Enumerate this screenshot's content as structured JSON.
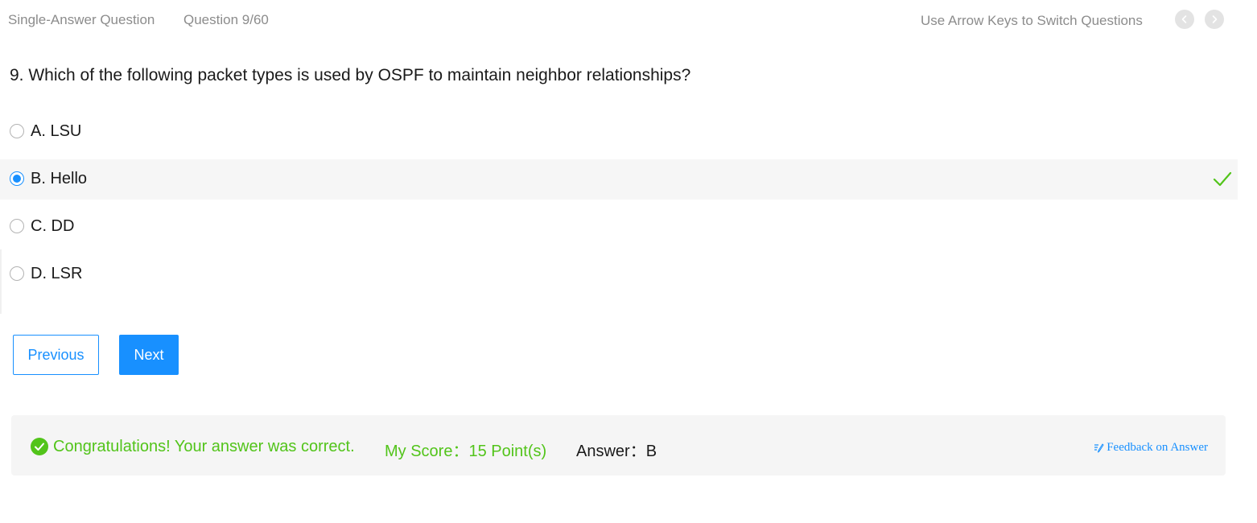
{
  "header": {
    "question_type": "Single-Answer Question",
    "progress": "Question 9/60",
    "hint": "Use Arrow Keys to Switch Questions",
    "prev_icon": "chevron-left-icon",
    "next_icon": "chevron-right-icon"
  },
  "question": {
    "text": "9. Which of the following packet types is used by OSPF to maintain neighbor relationships?"
  },
  "options": [
    {
      "label": "A. LSU",
      "selected": false
    },
    {
      "label": "B. Hello",
      "selected": true,
      "correct_icon": "checkmark-icon"
    },
    {
      "label": "C. DD",
      "selected": false
    },
    {
      "label": "D. LSR",
      "selected": false
    }
  ],
  "buttons": {
    "previous": "Previous",
    "next": "Next"
  },
  "result": {
    "icon": "check-circle-icon",
    "message": "Congratulations! Your answer was correct.",
    "score_label": "My Score：",
    "score_value": "15 Point(s)",
    "answer_label": "Answer：",
    "answer_value": "B",
    "feedback_label": "Feedback on Answer",
    "feedback_icon": "edit-note-icon"
  },
  "colors": {
    "primary": "#1890ff",
    "success": "#52c41a",
    "muted_text": "#8c8c8c",
    "selected_bg": "#f6f6f6",
    "panel_bg": "#f5f5f5"
  }
}
